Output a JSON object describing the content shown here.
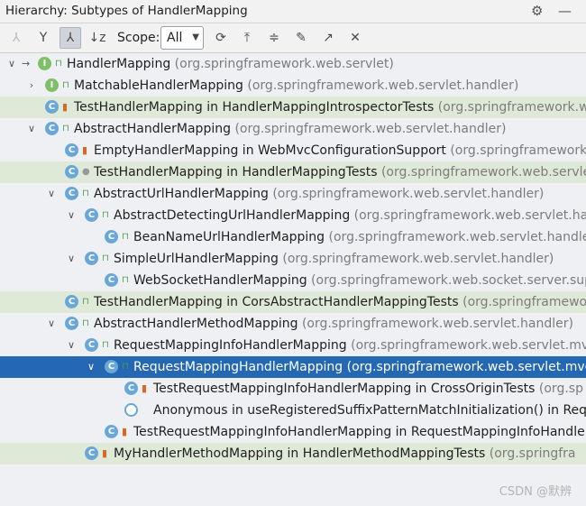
{
  "window": {
    "title": "Hierarchy:  Subtypes of HandlerMapping"
  },
  "toolbar": {
    "scope_label": "Scope:",
    "scope_value": "All"
  },
  "tree": [
    {
      "depth": 0,
      "expanded": true,
      "kind": "interface",
      "mark": "public",
      "name": "HandlerMapping",
      "pkg": "(org.springframework.web.servlet)",
      "base": true
    },
    {
      "depth": 1,
      "expanded": false,
      "kind": "interface",
      "mark": "public",
      "name": "MatchableHandlerMapping",
      "pkg": "(org.springframework.web.servlet.handler)"
    },
    {
      "depth": 1,
      "expanded": null,
      "kind": "class",
      "mark": "private",
      "name": "TestHandlerMapping in HandlerMappingIntrospectorTests",
      "pkg": "(org.springframework.w",
      "test": true
    },
    {
      "depth": 1,
      "expanded": true,
      "kind": "class",
      "mark": "public",
      "name": "AbstractHandlerMapping",
      "pkg": "(org.springframework.web.servlet.handler)"
    },
    {
      "depth": 2,
      "expanded": null,
      "kind": "class",
      "mark": "private",
      "name": "EmptyHandlerMapping in WebMvcConfigurationSupport",
      "pkg": "(org.springframework."
    },
    {
      "depth": 2,
      "expanded": null,
      "kind": "class",
      "mark": "package",
      "name": "TestHandlerMapping in HandlerMappingTests",
      "pkg": "(org.springframework.web.servle",
      "test": true
    },
    {
      "depth": 2,
      "expanded": true,
      "kind": "class",
      "mark": "public",
      "name": "AbstractUrlHandlerMapping",
      "pkg": "(org.springframework.web.servlet.handler)"
    },
    {
      "depth": 3,
      "expanded": true,
      "kind": "class",
      "mark": "public",
      "name": "AbstractDetectingUrlHandlerMapping",
      "pkg": "(org.springframework.web.servlet.han"
    },
    {
      "depth": 4,
      "expanded": null,
      "kind": "class",
      "mark": "public",
      "name": "BeanNameUrlHandlerMapping",
      "pkg": "(org.springframework.web.servlet.handler"
    },
    {
      "depth": 3,
      "expanded": true,
      "kind": "class",
      "mark": "public",
      "name": "SimpleUrlHandlerMapping",
      "pkg": "(org.springframework.web.servlet.handler)"
    },
    {
      "depth": 4,
      "expanded": null,
      "kind": "class",
      "mark": "public",
      "name": "WebSocketHandlerMapping",
      "pkg": "(org.springframework.web.socket.server.sup"
    },
    {
      "depth": 2,
      "expanded": null,
      "kind": "class",
      "mark": "public",
      "name": "TestHandlerMapping in CorsAbstractHandlerMappingTests",
      "pkg": "(org.springframewo",
      "test": true
    },
    {
      "depth": 2,
      "expanded": true,
      "kind": "class",
      "mark": "public",
      "name": "AbstractHandlerMethodMapping",
      "pkg": "(org.springframework.web.servlet.handler)"
    },
    {
      "depth": 3,
      "expanded": true,
      "kind": "class",
      "mark": "public",
      "name": "RequestMappingInfoHandlerMapping",
      "pkg": "(org.springframework.web.servlet.mvc"
    },
    {
      "depth": 4,
      "expanded": true,
      "kind": "class",
      "mark": "public",
      "name": "RequestMappingHandlerMapping",
      "pkg": "(org.springframework.web.servlet.mvc",
      "selected": true
    },
    {
      "depth": 5,
      "expanded": null,
      "kind": "class",
      "mark": "private",
      "name": "TestRequestMappingInfoHandlerMapping in CrossOriginTests",
      "pkg": "(org.sp"
    },
    {
      "depth": 5,
      "expanded": null,
      "kind": "anon",
      "mark": "",
      "name": "Anonymous in useRegisteredSuffixPatternMatchInitialization() in Requ",
      "pkg": ""
    },
    {
      "depth": 4,
      "expanded": null,
      "kind": "class",
      "mark": "private",
      "name": "TestRequestMappingInfoHandlerMapping in RequestMappingInfoHandle",
      "pkg": ""
    },
    {
      "depth": 3,
      "expanded": null,
      "kind": "class",
      "mark": "private",
      "name": "MyHandlerMethodMapping in HandlerMethodMappingTests",
      "pkg": "(org.springfra",
      "test": true
    }
  ],
  "watermark": "CSDN @默辨"
}
